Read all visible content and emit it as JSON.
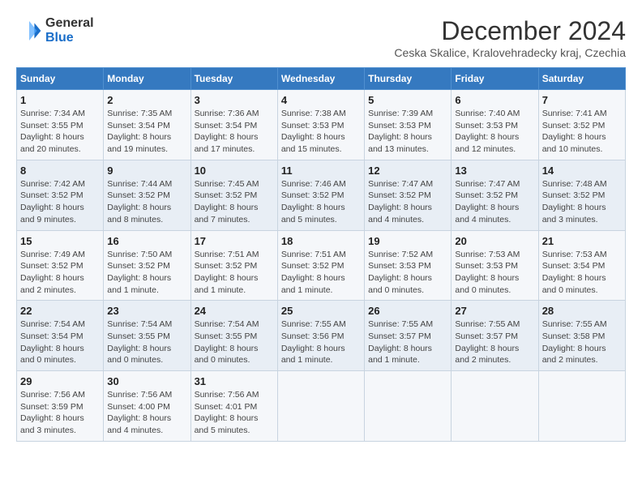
{
  "header": {
    "logo_general": "General",
    "logo_blue": "Blue",
    "title": "December 2024",
    "subtitle": "Ceska Skalice, Kralovehradecky kraj, Czechia"
  },
  "weekdays": [
    "Sunday",
    "Monday",
    "Tuesday",
    "Wednesday",
    "Thursday",
    "Friday",
    "Saturday"
  ],
  "weeks": [
    [
      {
        "day": "1",
        "sunrise": "Sunrise: 7:34 AM",
        "sunset": "Sunset: 3:55 PM",
        "daylight": "Daylight: 8 hours and 20 minutes."
      },
      {
        "day": "2",
        "sunrise": "Sunrise: 7:35 AM",
        "sunset": "Sunset: 3:54 PM",
        "daylight": "Daylight: 8 hours and 19 minutes."
      },
      {
        "day": "3",
        "sunrise": "Sunrise: 7:36 AM",
        "sunset": "Sunset: 3:54 PM",
        "daylight": "Daylight: 8 hours and 17 minutes."
      },
      {
        "day": "4",
        "sunrise": "Sunrise: 7:38 AM",
        "sunset": "Sunset: 3:53 PM",
        "daylight": "Daylight: 8 hours and 15 minutes."
      },
      {
        "day": "5",
        "sunrise": "Sunrise: 7:39 AM",
        "sunset": "Sunset: 3:53 PM",
        "daylight": "Daylight: 8 hours and 13 minutes."
      },
      {
        "day": "6",
        "sunrise": "Sunrise: 7:40 AM",
        "sunset": "Sunset: 3:53 PM",
        "daylight": "Daylight: 8 hours and 12 minutes."
      },
      {
        "day": "7",
        "sunrise": "Sunrise: 7:41 AM",
        "sunset": "Sunset: 3:52 PM",
        "daylight": "Daylight: 8 hours and 10 minutes."
      }
    ],
    [
      {
        "day": "8",
        "sunrise": "Sunrise: 7:42 AM",
        "sunset": "Sunset: 3:52 PM",
        "daylight": "Daylight: 8 hours and 9 minutes."
      },
      {
        "day": "9",
        "sunrise": "Sunrise: 7:44 AM",
        "sunset": "Sunset: 3:52 PM",
        "daylight": "Daylight: 8 hours and 8 minutes."
      },
      {
        "day": "10",
        "sunrise": "Sunrise: 7:45 AM",
        "sunset": "Sunset: 3:52 PM",
        "daylight": "Daylight: 8 hours and 7 minutes."
      },
      {
        "day": "11",
        "sunrise": "Sunrise: 7:46 AM",
        "sunset": "Sunset: 3:52 PM",
        "daylight": "Daylight: 8 hours and 5 minutes."
      },
      {
        "day": "12",
        "sunrise": "Sunrise: 7:47 AM",
        "sunset": "Sunset: 3:52 PM",
        "daylight": "Daylight: 8 hours and 4 minutes."
      },
      {
        "day": "13",
        "sunrise": "Sunrise: 7:47 AM",
        "sunset": "Sunset: 3:52 PM",
        "daylight": "Daylight: 8 hours and 4 minutes."
      },
      {
        "day": "14",
        "sunrise": "Sunrise: 7:48 AM",
        "sunset": "Sunset: 3:52 PM",
        "daylight": "Daylight: 8 hours and 3 minutes."
      }
    ],
    [
      {
        "day": "15",
        "sunrise": "Sunrise: 7:49 AM",
        "sunset": "Sunset: 3:52 PM",
        "daylight": "Daylight: 8 hours and 2 minutes."
      },
      {
        "day": "16",
        "sunrise": "Sunrise: 7:50 AM",
        "sunset": "Sunset: 3:52 PM",
        "daylight": "Daylight: 8 hours and 1 minute."
      },
      {
        "day": "17",
        "sunrise": "Sunrise: 7:51 AM",
        "sunset": "Sunset: 3:52 PM",
        "daylight": "Daylight: 8 hours and 1 minute."
      },
      {
        "day": "18",
        "sunrise": "Sunrise: 7:51 AM",
        "sunset": "Sunset: 3:52 PM",
        "daylight": "Daylight: 8 hours and 1 minute."
      },
      {
        "day": "19",
        "sunrise": "Sunrise: 7:52 AM",
        "sunset": "Sunset: 3:53 PM",
        "daylight": "Daylight: 8 hours and 0 minutes."
      },
      {
        "day": "20",
        "sunrise": "Sunrise: 7:53 AM",
        "sunset": "Sunset: 3:53 PM",
        "daylight": "Daylight: 8 hours and 0 minutes."
      },
      {
        "day": "21",
        "sunrise": "Sunrise: 7:53 AM",
        "sunset": "Sunset: 3:54 PM",
        "daylight": "Daylight: 8 hours and 0 minutes."
      }
    ],
    [
      {
        "day": "22",
        "sunrise": "Sunrise: 7:54 AM",
        "sunset": "Sunset: 3:54 PM",
        "daylight": "Daylight: 8 hours and 0 minutes."
      },
      {
        "day": "23",
        "sunrise": "Sunrise: 7:54 AM",
        "sunset": "Sunset: 3:55 PM",
        "daylight": "Daylight: 8 hours and 0 minutes."
      },
      {
        "day": "24",
        "sunrise": "Sunrise: 7:54 AM",
        "sunset": "Sunset: 3:55 PM",
        "daylight": "Daylight: 8 hours and 0 minutes."
      },
      {
        "day": "25",
        "sunrise": "Sunrise: 7:55 AM",
        "sunset": "Sunset: 3:56 PM",
        "daylight": "Daylight: 8 hours and 1 minute."
      },
      {
        "day": "26",
        "sunrise": "Sunrise: 7:55 AM",
        "sunset": "Sunset: 3:57 PM",
        "daylight": "Daylight: 8 hours and 1 minute."
      },
      {
        "day": "27",
        "sunrise": "Sunrise: 7:55 AM",
        "sunset": "Sunset: 3:57 PM",
        "daylight": "Daylight: 8 hours and 2 minutes."
      },
      {
        "day": "28",
        "sunrise": "Sunrise: 7:55 AM",
        "sunset": "Sunset: 3:58 PM",
        "daylight": "Daylight: 8 hours and 2 minutes."
      }
    ],
    [
      {
        "day": "29",
        "sunrise": "Sunrise: 7:56 AM",
        "sunset": "Sunset: 3:59 PM",
        "daylight": "Daylight: 8 hours and 3 minutes."
      },
      {
        "day": "30",
        "sunrise": "Sunrise: 7:56 AM",
        "sunset": "Sunset: 4:00 PM",
        "daylight": "Daylight: 8 hours and 4 minutes."
      },
      {
        "day": "31",
        "sunrise": "Sunrise: 7:56 AM",
        "sunset": "Sunset: 4:01 PM",
        "daylight": "Daylight: 8 hours and 5 minutes."
      },
      null,
      null,
      null,
      null
    ]
  ]
}
